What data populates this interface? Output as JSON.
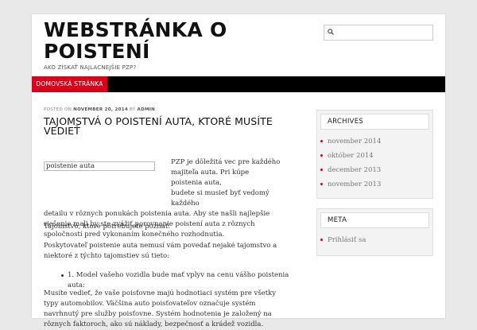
{
  "header": {
    "site_title": "WEBSTRÁNKA O POISTENÍ",
    "tagline": "AKO ZÍSKAŤ NAJLACNEJŠIE PZP?",
    "search_placeholder": ""
  },
  "nav": {
    "home_label": "DOMOVSKÁ STRÁNKA"
  },
  "post": {
    "meta_posted_on": "POSTED ON",
    "meta_date": "NOVEMBER 20, 2014",
    "meta_by": "BY",
    "meta_author": "ADMIN",
    "title": "TAJOMSTVÁ O POISTENÍ AUTA, KTORÉ MUSÍTE VEDIEŤ",
    "image_alt": "poistenie auta",
    "p1_l1": "PZP je dôležitá vec pre každého",
    "p1_l2": "majiteľa auta. Pri kúpe poistenia auta,",
    "p1_l3": "budete si musieť byť vedomý každého",
    "p1_l4": "detailu v rôznych ponukách poistenia auta. Aby ste našli najlepšie riešenie mali by ste zvážiť porovnanie poistení auta z rôznych spoločností pred vykonaním konečného rozhodnutia.",
    "p2": "Tajomstvo, ktoré potrebujete poznať:",
    "p3": "Poskytovateľ poistenie auta nemusí vám povedať nejaké tajomstvo a niektoré z týchto tajomstiev sú tieto:",
    "list_item_1": "1. Model vašeho vozidla bude mať vplyv na cenu vášho poistenia auta:",
    "p4": "Musíte vedieť, že vaše poisťovne majú hodnotiaci systém pre všetky typy automobilov. Väčšina auto poisťovateľov označuje systém navrhnutý pre služby poisťovne. Systém hodnotenia je založený na rôznych faktoroch, ako sú náklady, bezpečnosť a krádež vozidla."
  },
  "sidebar": {
    "archives_title": "ARCHIVES",
    "archives": [
      "november 2014",
      "október 2014",
      "december 2013",
      "november 2013"
    ],
    "meta_title": "META",
    "meta_links": [
      "Prihlásiť sa"
    ]
  },
  "colors": {
    "accent": "#d9011a",
    "nav": "#000000"
  }
}
